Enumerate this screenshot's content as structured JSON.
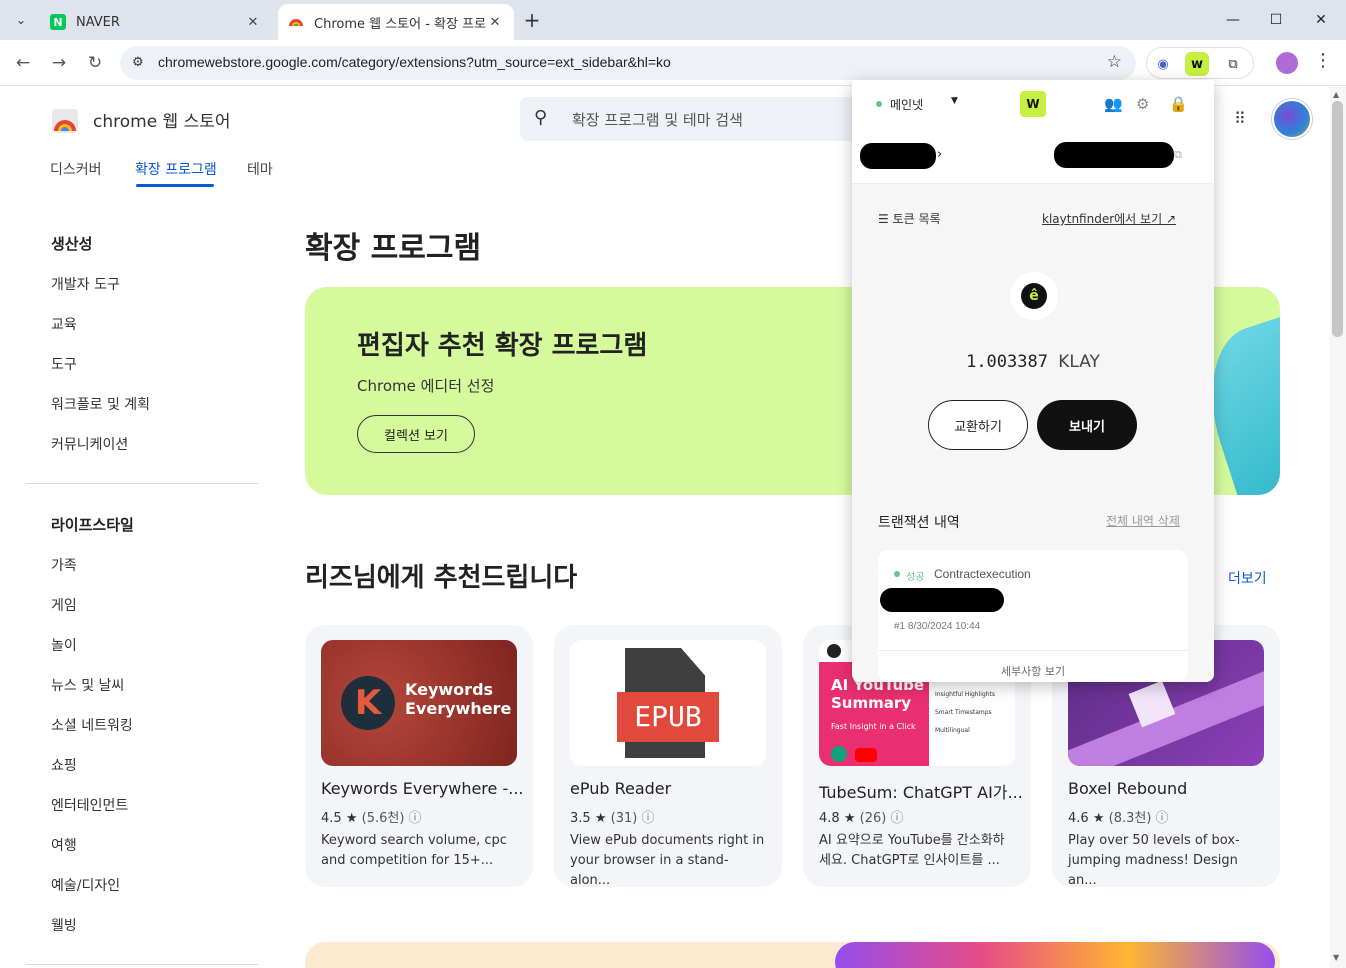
{
  "tabs": [
    {
      "title": "NAVER",
      "favicon": "naver-n-icon"
    },
    {
      "title": "Chrome 웹 스토어 - 확장 프로",
      "favicon": "chrome-webstore-icon"
    }
  ],
  "toolbar": {
    "url": "chromewebstore.google.com/category/extensions?utm_source=ext_sidebar&hl=ko"
  },
  "store": {
    "name": "chrome 웹 스토어",
    "search_placeholder": "확장 프로그램 및 테마 검색",
    "nav": [
      "디스커버",
      "확장 프로그램",
      "테마"
    ]
  },
  "sidebar": {
    "sections": [
      {
        "title": "생산성",
        "items": [
          "개발자 도구",
          "교육",
          "도구",
          "워크플로 및 계획",
          "커뮤니케이션"
        ]
      },
      {
        "title": "라이프스타일",
        "items": [
          "가족",
          "게임",
          "놀이",
          "뉴스 및 날씨",
          "소셜 네트워킹",
          "쇼핑",
          "엔터테인먼트",
          "여행",
          "예술/디자인",
          "웰빙"
        ]
      }
    ]
  },
  "main": {
    "heading": "확장 프로그램",
    "banner": {
      "title": "편집자 추천 확장 프로그램",
      "subtitle": "Chrome 에디터 선정",
      "button": "컬렉션 보기"
    },
    "recommend_heading": "리즈님에게 추천드립니다",
    "more": "더보기",
    "cards": [
      {
        "name": "Keywords Everywhere -...",
        "rating": "4.5",
        "count": "(5.6천)",
        "desc": "Keyword search volume, cpc and competition for 15+...",
        "thumb_text": "Keywords Everywhere",
        "thumb_letter": "K"
      },
      {
        "name": "ePub Reader",
        "rating": "3.5",
        "count": "(31)",
        "desc": "View ePub documents right in your browser in a stand-alon...",
        "thumb_text": "EPUB"
      },
      {
        "name": "TubeSum: ChatGPT AI가...",
        "rating": "4.8",
        "count": "(26)",
        "desc": "AI 요약으로 YouTube를 간소화하세요. ChatGPT로 인사이트를 ...",
        "thumb_text": "AI YouTube Summary",
        "thumb_sub": "Fast Insight in a Click",
        "thumb_list": [
          "Insightful Highlights",
          "Smart Timestamps",
          "Multilingual"
        ]
      },
      {
        "name": "Boxel Rebound",
        "rating": "4.6",
        "count": "(8.3천)",
        "desc": "Play over 50 levels of box-jumping madness! Design an..."
      }
    ]
  },
  "wallet": {
    "network": "메인넷",
    "token_list": "토큰 목록",
    "finder_link": "klaytnfinder에서 보기",
    "balance": "1.003387",
    "unit": "KLAY",
    "swap": "교환하기",
    "send": "보내기",
    "tx_heading": "트랜잭션 내역",
    "tx_clear": "전체 내역 삭제",
    "tx": {
      "status": "성공",
      "type": "Contractexecution",
      "meta": "#1 8/30/2024 10:44",
      "detail": "세부사항 보기"
    }
  }
}
